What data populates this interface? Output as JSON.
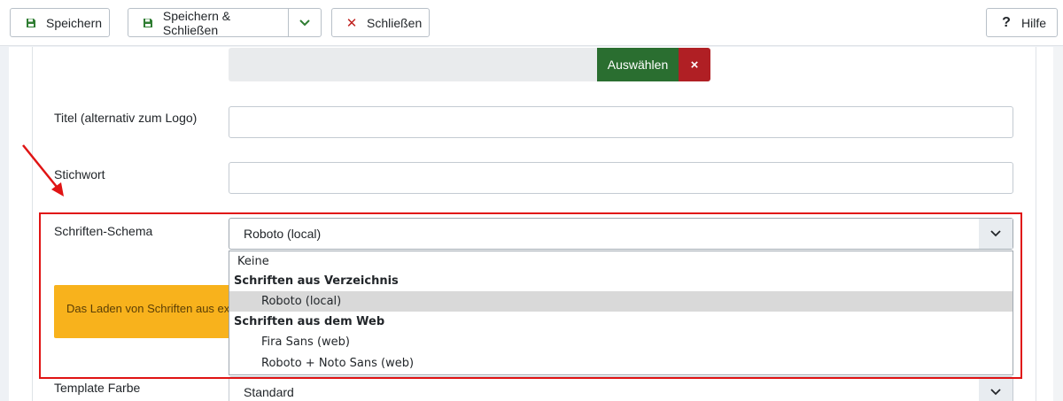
{
  "toolbar": {
    "save_label": "Speichern",
    "save_close_label": "Speichern & Schließen",
    "close_label": "Schließen",
    "help_label": "Hilfe"
  },
  "media": {
    "choose_label": "Auswählen",
    "clear_symbol": "×"
  },
  "fields": {
    "title_label": "Titel (alternativ zum Logo)",
    "keyword_label": "Stichwort",
    "font_scheme_label": "Schriften-Schema",
    "font_scheme_value": "Roboto (local)",
    "template_color_label": "Template Farbe",
    "template_color_value": "Standard"
  },
  "warning_text": "Das Laden von Schriften aus externen Quellen",
  "dropdown": {
    "options": [
      {
        "text": "Keine",
        "kind": "option"
      },
      {
        "text": "Schriften aus Verzeichnis",
        "kind": "group"
      },
      {
        "text": "Roboto (local)",
        "kind": "sub",
        "selected": true
      },
      {
        "text": "Schriften aus dem Web",
        "kind": "group"
      },
      {
        "text": "Fira Sans (web)",
        "kind": "sub"
      },
      {
        "text": "Roboto + Noto Sans (web)",
        "kind": "sub"
      }
    ]
  },
  "colors": {
    "save_green": "#2f7d32",
    "choose_green": "#2a6e30",
    "clear_red": "#b01f24",
    "warning_orange": "#f8b21c",
    "highlight_red": "#e01414"
  }
}
